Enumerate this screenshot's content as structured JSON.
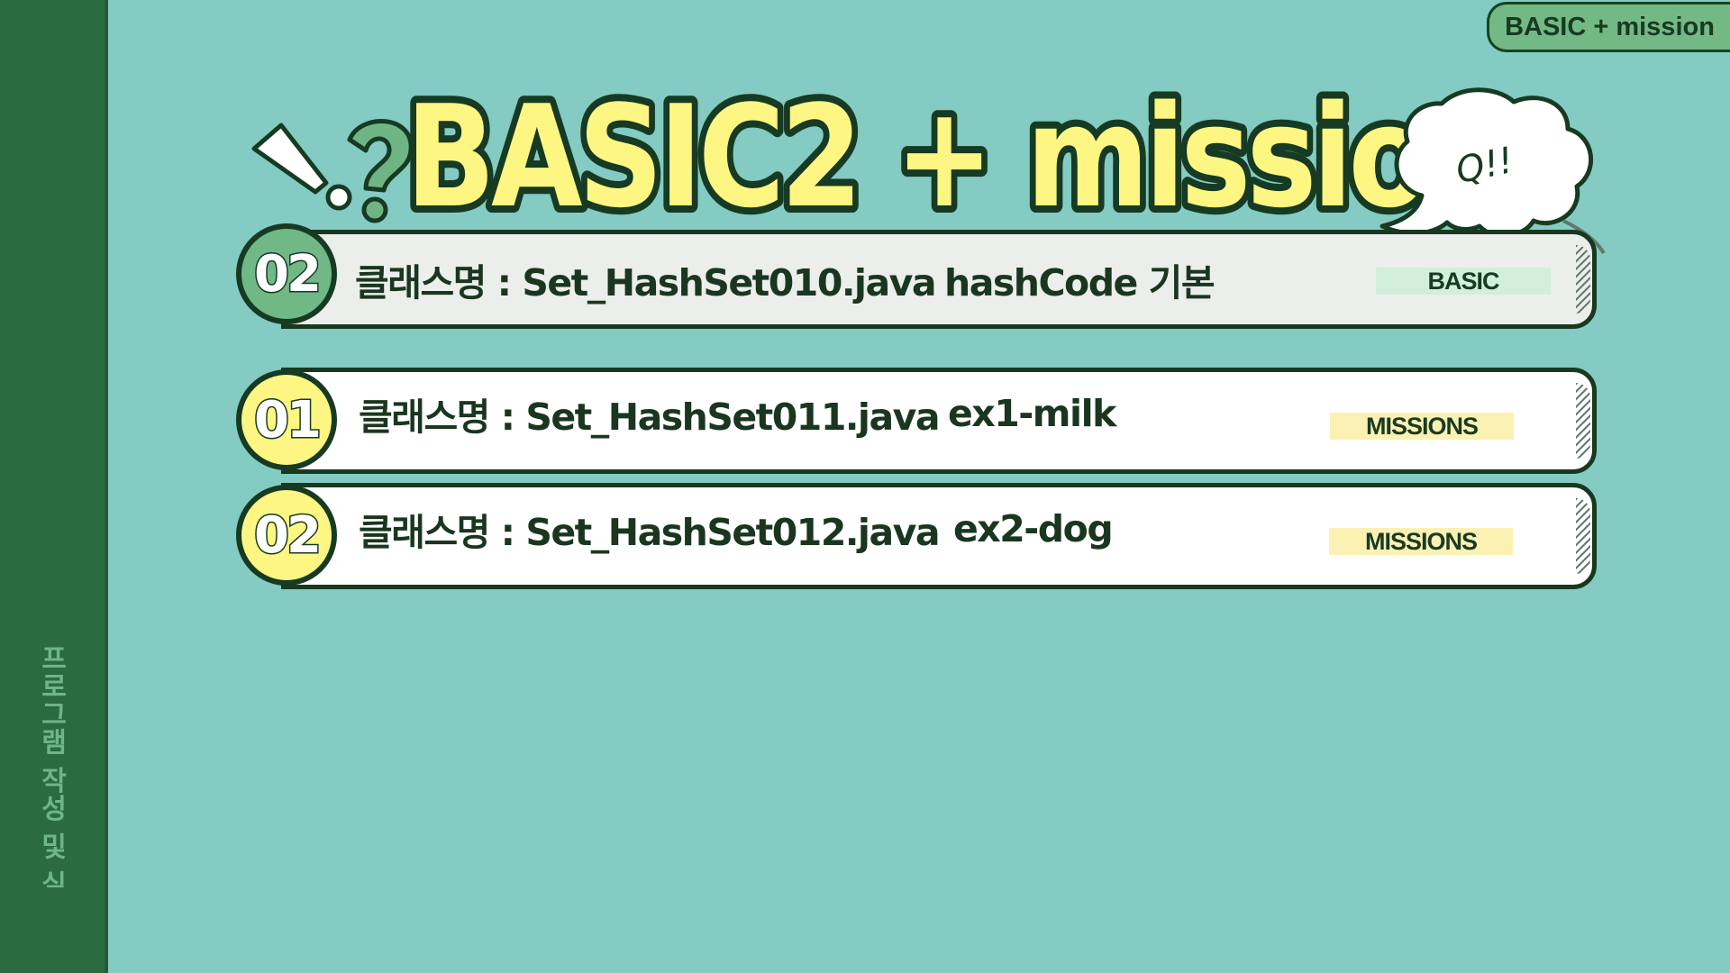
{
  "sidebar": {
    "label": "프로그램 작성 및 실행"
  },
  "tag": {
    "label": "BASIC + mission"
  },
  "title": {
    "text": "BASIC2 + mission",
    "bubble": "Q!!"
  },
  "rows": [
    {
      "num": "02",
      "kind": "basic",
      "class_label": "클래스명 : Set_HashSet010.java",
      "topic": "hashCode 기본",
      "badge": "BASIC"
    },
    {
      "num": "01",
      "kind": "mission",
      "class_label": "클래스명 : Set_HashSet011.java",
      "topic": "ex1-milk",
      "badge": "MISSIONS"
    },
    {
      "num": "02",
      "kind": "mission",
      "class_label": "클래스명 : Set_HashSet012.java",
      "topic": "ex2-dog",
      "badge": "MISSIONS"
    }
  ],
  "colors": {
    "background": "#83cbc3",
    "sidebar": "#2a6b40",
    "title_fill": "#fef682",
    "outline": "#163a22",
    "basic_circle": "#70b885",
    "mission_circle": "#fef682"
  }
}
